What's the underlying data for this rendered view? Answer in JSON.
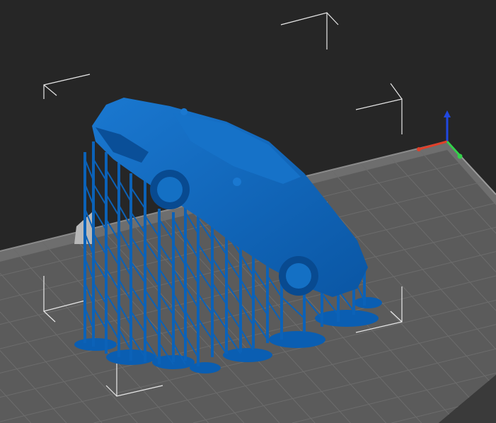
{
  "viewport": {
    "background_color": "#262626",
    "plate_color": "#5b5b5b",
    "model_color": "#0b62b8",
    "axis_colors": {
      "x": "#e0402a",
      "y": "#33d14a",
      "z": "#2048e0"
    }
  }
}
